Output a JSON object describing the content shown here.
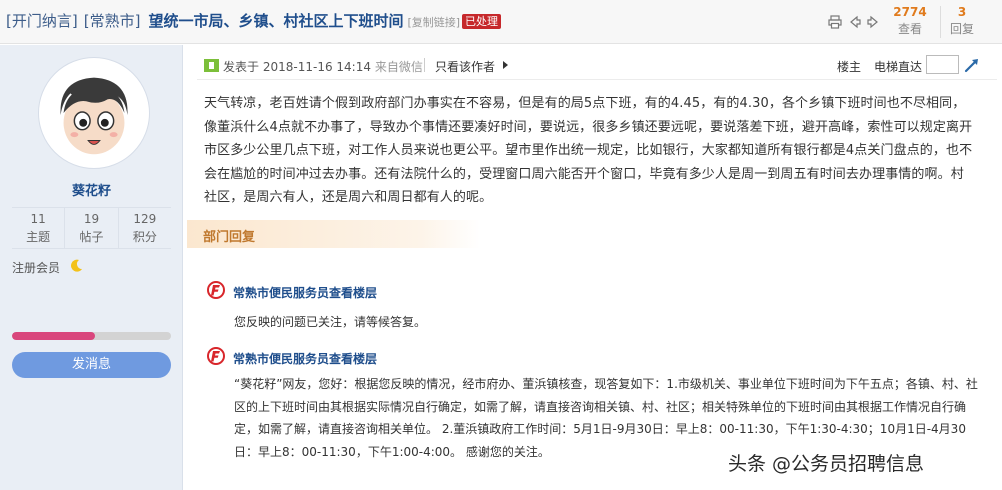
{
  "title": {
    "category1": "[开门纳言]",
    "category2": "[常熟市]",
    "main": "望统一市局、乡镇、村社区上下班时间",
    "copy_link": "[复制链接]",
    "status_badge": "已处理"
  },
  "toolbar": {
    "icons": [
      "print-icon",
      "prev-icon",
      "next-icon"
    ],
    "views_count": "2774",
    "views_label": "查看",
    "replies_count": "3",
    "replies_label": "回复"
  },
  "user": {
    "name": "葵花籽",
    "stats": [
      {
        "value": "11",
        "label": "主题"
      },
      {
        "value": "19",
        "label": "帖子"
      },
      {
        "value": "129",
        "label": "积分"
      }
    ],
    "level": "注册会员",
    "progress": 0.52,
    "send_button": "发消息"
  },
  "post_header": {
    "posted_prefix": "发表于",
    "datetime": "2018-11-16 14:14",
    "source": "来自微信",
    "only_author": "只看该作者",
    "floor_label": "楼主",
    "jump_label": "电梯直达"
  },
  "post_body": "天气转凉，老百姓请个假到政府部门办事实在不容易，但是有的局5点下班，有的4.45，有的4.30，各个乡镇下班时间也不尽相同，像董浜什么4点就不办事了，导致办个事情还要凑好时间，要说远，很多乡镇还要远呢，要说落差下班，避开高峰，索性可以规定离开市区多少公里几点下班，对工作人员来说也更公平。望市里作出统一规定，比如银行，大家都知道所有银行都是4点关门盘点的，也不会在尴尬的时间冲过去办事。还有法院什么的，受理窗口周六能否开个窗口，毕竟有多少人是周一到周五有时间去办理事情的啊。村社区，是周六有人，还是周六和周日都有人的呢。",
  "dept_reply_label": "部门回复",
  "replies": [
    {
      "author": "常熟市便民服务员查看楼层",
      "text": "您反映的问题已关注，请等候答复。"
    },
    {
      "author": "常熟市便民服务员查看楼层",
      "text": "“葵花籽”网友，您好：根据您反映的情况，经市府办、董浜镇核查，现答复如下：1.市级机关、事业单位下班时间为下午五点；各镇、村、社区的上下班时间由其根据实际情况自行确定，如需了解，请直接咨询相关镇、村、社区；相关特殊单位的下班时间由其根据工作情况自行确定，如需了解，请直接咨询相关单位。 2.董浜镇政府工作时间：5月1日-9月30日：早上8：00-11:30，下午1:30-4:30；10月1日-4月30日：早上8：00-11:30，下午1:00-4:00。 感谢您的关注。"
    }
  ],
  "watermark": "头条 @公务员招聘信息",
  "colors": {
    "accent_blue": "#1f4e8c",
    "badge_red": "#c6282b",
    "stat_orange": "#e07b1d",
    "button_blue": "#6f9ae0",
    "progress_pink": "#d9467c"
  }
}
